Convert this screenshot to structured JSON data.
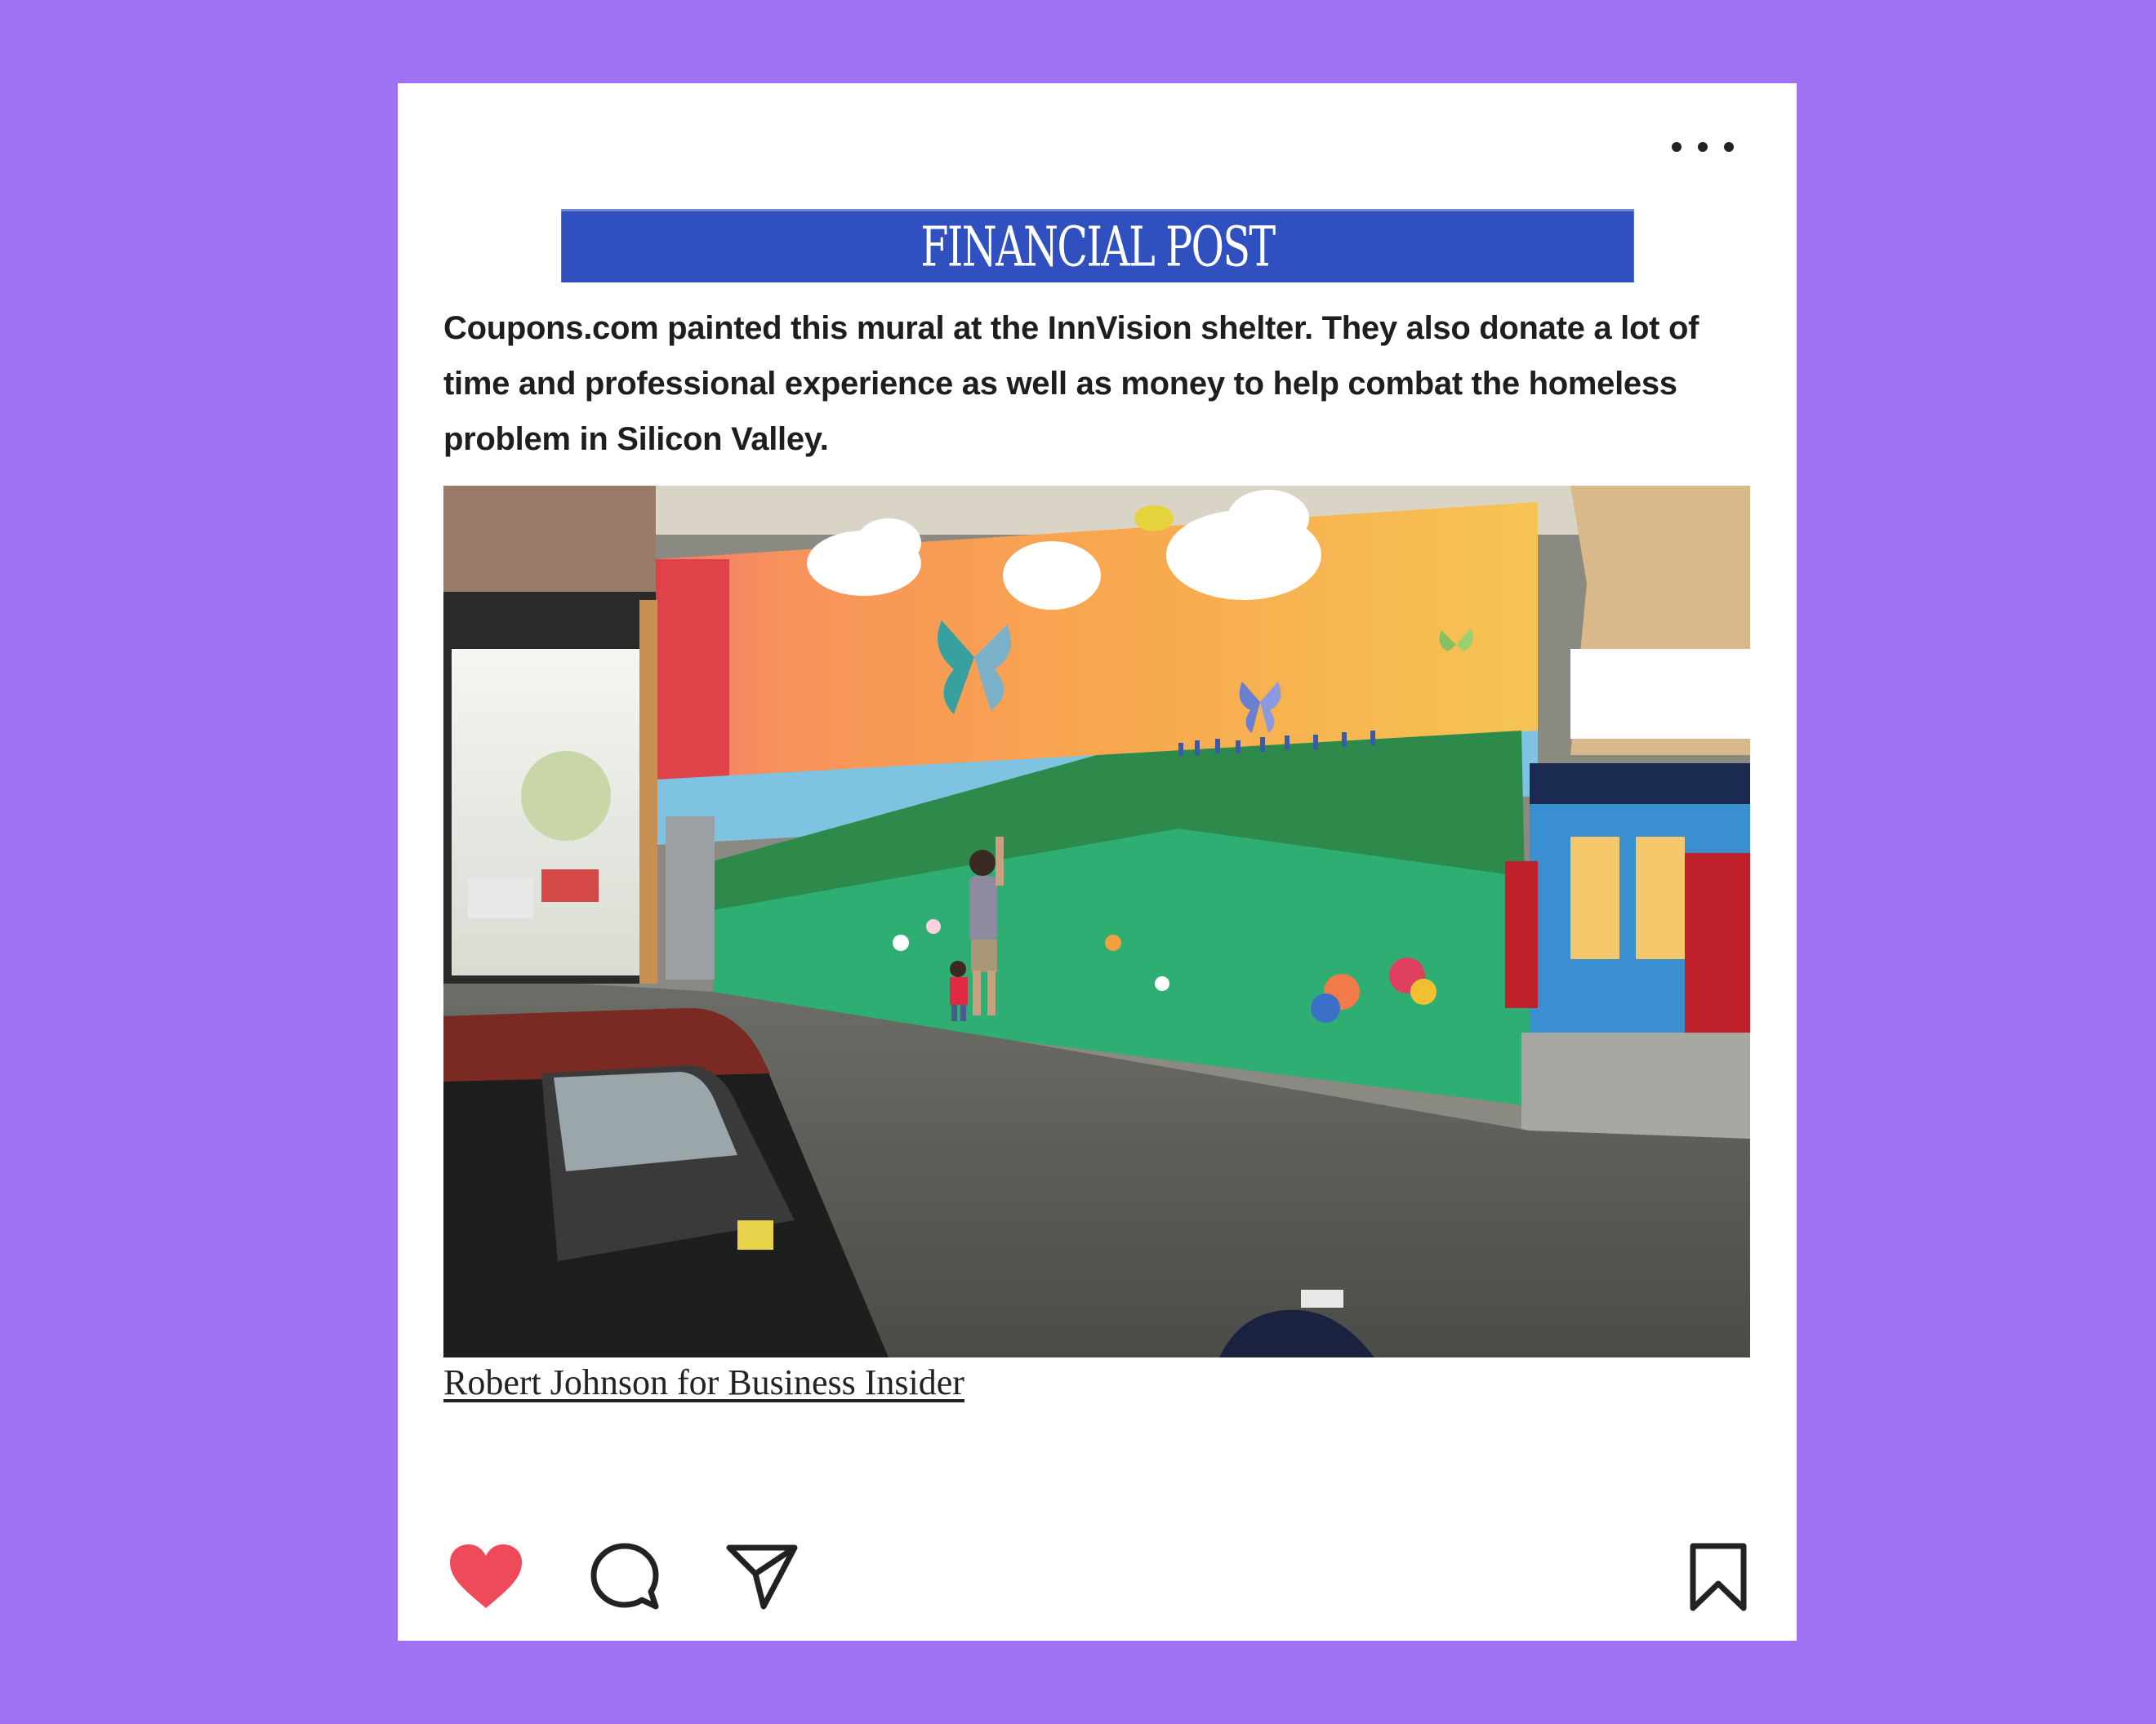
{
  "post": {
    "publication": "FINANCIAL POST",
    "headline": "Coupons.com painted this mural at the InnVision shelter. They also donate a lot of time and professional experience as well as money to help combat the homeless problem in Silicon Valley.",
    "photo_credit": "Robert Johnson for Business Insider",
    "liked": true
  },
  "icons": {
    "more": "more-options-icon",
    "like": "heart-icon",
    "comment": "comment-icon",
    "share": "send-icon",
    "save": "bookmark-icon"
  },
  "colors": {
    "background": "#a070f5",
    "card": "#ffffff",
    "masthead": "#3050c0",
    "like_active": "#ee4a5a"
  }
}
